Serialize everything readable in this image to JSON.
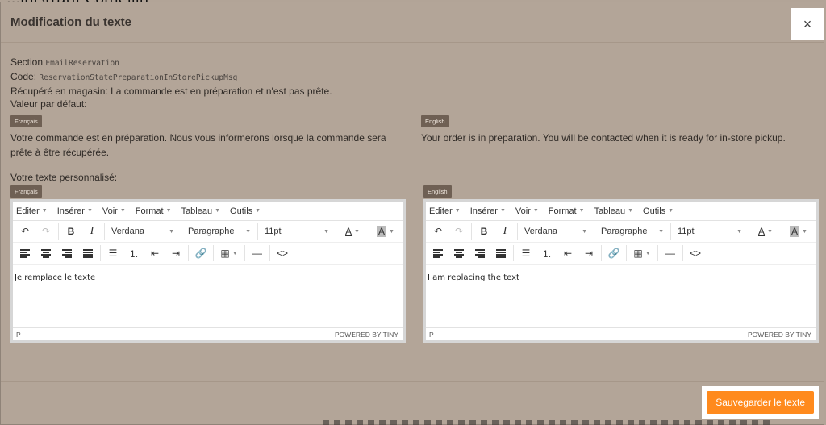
{
  "background": {
    "title": "...inistratif Comeilin"
  },
  "modal": {
    "title": "Modification du texte",
    "close_label": "×",
    "section_label": "Section",
    "section_value": "EmailReservation",
    "code_label": "Code:",
    "code_value": "ReservationStatePreparationInStorePickupMsg",
    "description": "Récupéré en magasin: La commande est en préparation et n'est pas prête.",
    "default_label": "Valeur par défaut:",
    "custom_label": "Votre texte personnalisé:",
    "save_label": "Sauvegarder le texte"
  },
  "defaults": [
    {
      "lang": "Français",
      "text": "Votre commande est en préparation. Nous vous informerons lorsque la commande sera prête à être récupérée."
    },
    {
      "lang": "English",
      "text": "Your order is in preparation. You will be contacted when it is ready for in-store pickup."
    }
  ],
  "editors": [
    {
      "lang": "Français",
      "menu": [
        "Editer",
        "Insérer",
        "Voir",
        "Format",
        "Tableau",
        "Outils"
      ],
      "font": "Verdana",
      "block": "Paragraphe",
      "size": "11pt",
      "content": "Je remplace le texte",
      "status_path": "P",
      "branding": "POWERED BY TINY"
    },
    {
      "lang": "English",
      "menu": [
        "Editer",
        "Insérer",
        "Voir",
        "Format",
        "Tableau",
        "Outils"
      ],
      "font": "Verdana",
      "block": "Paragraphe",
      "size": "11pt",
      "content": "I am replacing the text",
      "status_path": "P",
      "branding": "POWERED BY TINY"
    }
  ],
  "colors": {
    "accent": "#ff8a1d",
    "overlay": "#b3a598",
    "tag": "#6f6054"
  }
}
